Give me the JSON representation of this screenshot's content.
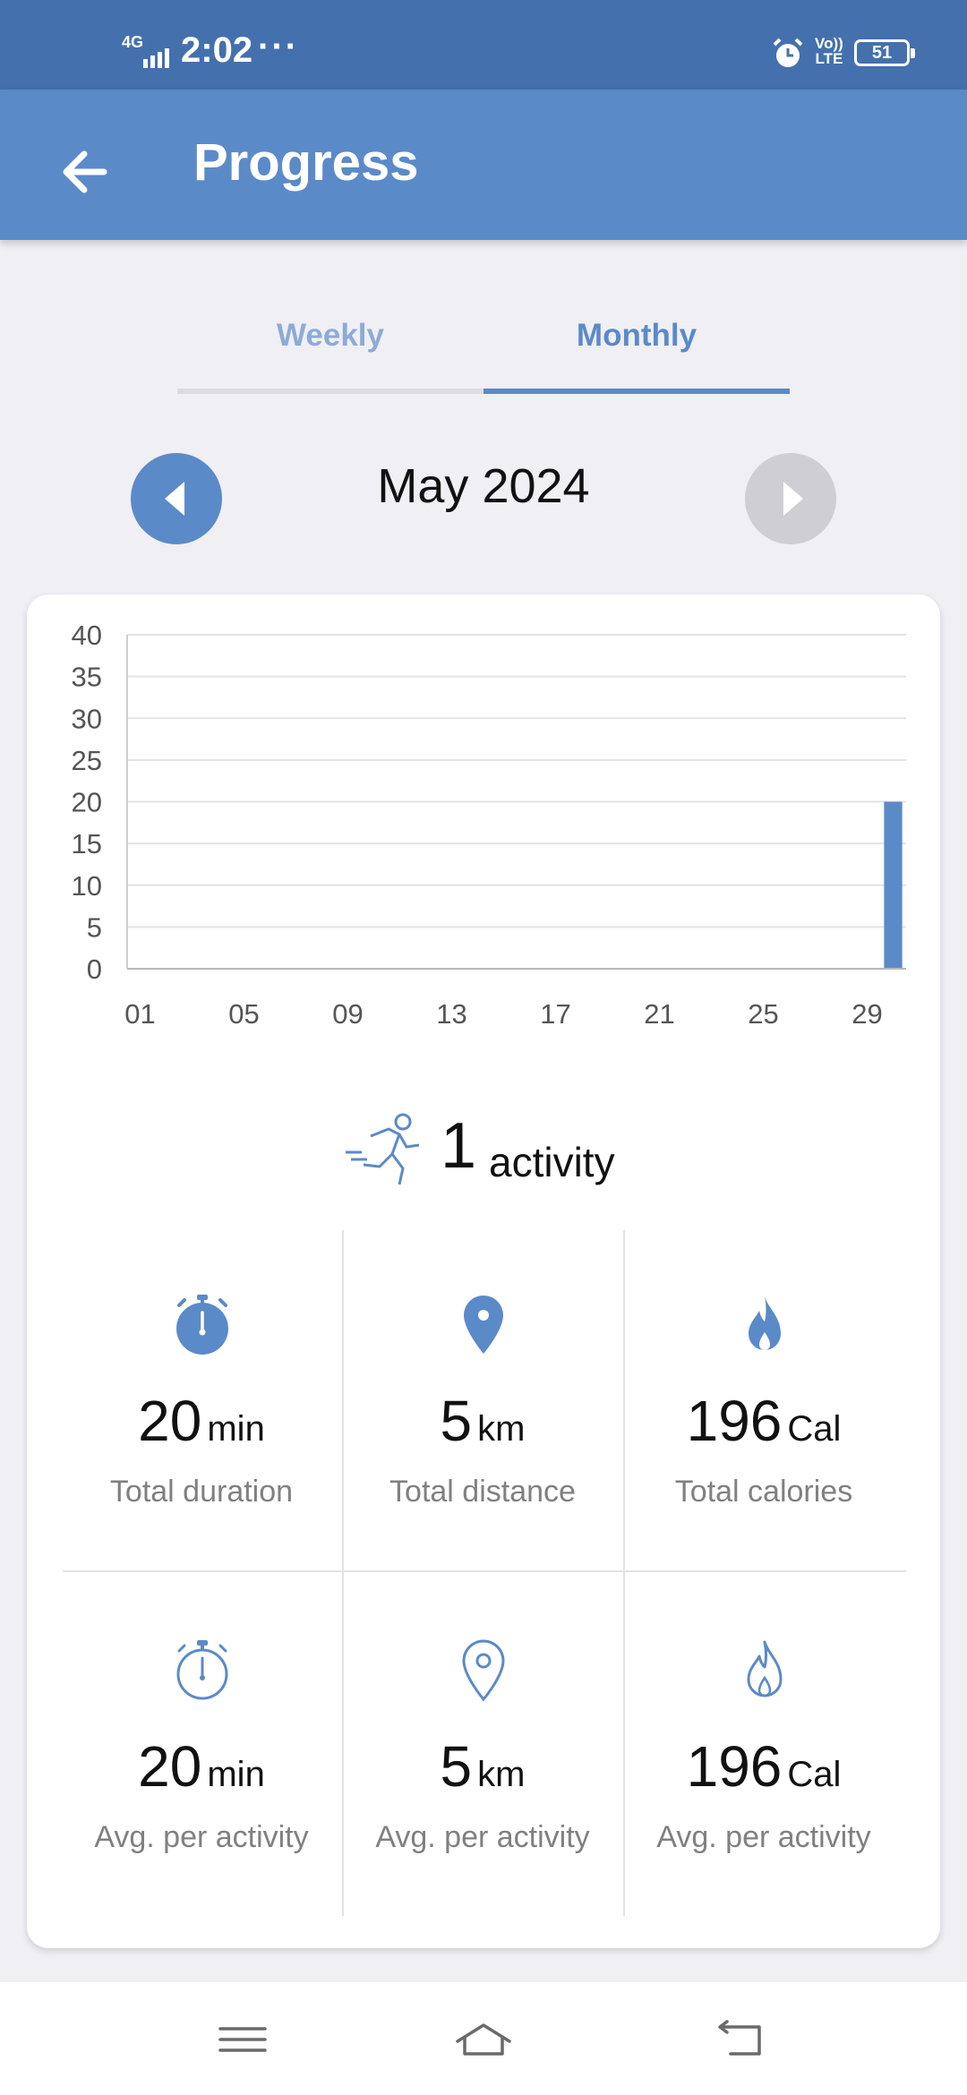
{
  "status_bar": {
    "network": "4G",
    "time": "2:02",
    "dots": "···",
    "volte_line1": "Vo))",
    "volte_line2": "LTE",
    "battery": "51"
  },
  "app_bar": {
    "title": "Progress",
    "back_icon": "arrow-left-icon"
  },
  "tabs": [
    {
      "label": "Weekly",
      "selected": false
    },
    {
      "label": "Monthly",
      "selected": true
    }
  ],
  "period": {
    "label": "May 2024",
    "prev_icon": "caret-left-icon",
    "next_icon": "caret-right-icon"
  },
  "chart_data": {
    "type": "bar",
    "y_ticks": [
      0,
      5,
      10,
      15,
      20,
      25,
      30,
      35,
      40
    ],
    "ylim": [
      0,
      40
    ],
    "x_tick_labels": [
      "01",
      "05",
      "09",
      "13",
      "17",
      "21",
      "25",
      "29"
    ],
    "days": 30,
    "points": [
      {
        "x": 30,
        "y": 20
      }
    ],
    "grid": true,
    "bar_color": "#5b8ac8"
  },
  "summary": {
    "count": "1",
    "unit": "activity",
    "icon": "runner-icon"
  },
  "stats": [
    {
      "icon": "stopwatch-filled-icon",
      "value": "20",
      "unit": "min",
      "label": "Total duration"
    },
    {
      "icon": "location-pin-filled-icon",
      "value": "5",
      "unit": "km",
      "label": "Total distance"
    },
    {
      "icon": "flame-filled-icon",
      "value": "196",
      "unit": "Cal",
      "label": "Total calories"
    },
    {
      "icon": "stopwatch-outline-icon",
      "value": "20",
      "unit": "min",
      "label": "Avg. per activity"
    },
    {
      "icon": "location-pin-outline-icon",
      "value": "5",
      "unit": "km",
      "label": "Avg. per activity"
    },
    {
      "icon": "flame-outline-icon",
      "value": "196",
      "unit": "Cal",
      "label": "Avg. per activity"
    }
  ],
  "colors": {
    "status_bar": "#4470ae",
    "app_bar": "#5b8ac8",
    "accent": "#5b8ac8",
    "background": "#efeff4"
  },
  "navigation_bar": {
    "icons": [
      "menu-icon",
      "home-icon",
      "back-icon"
    ]
  }
}
